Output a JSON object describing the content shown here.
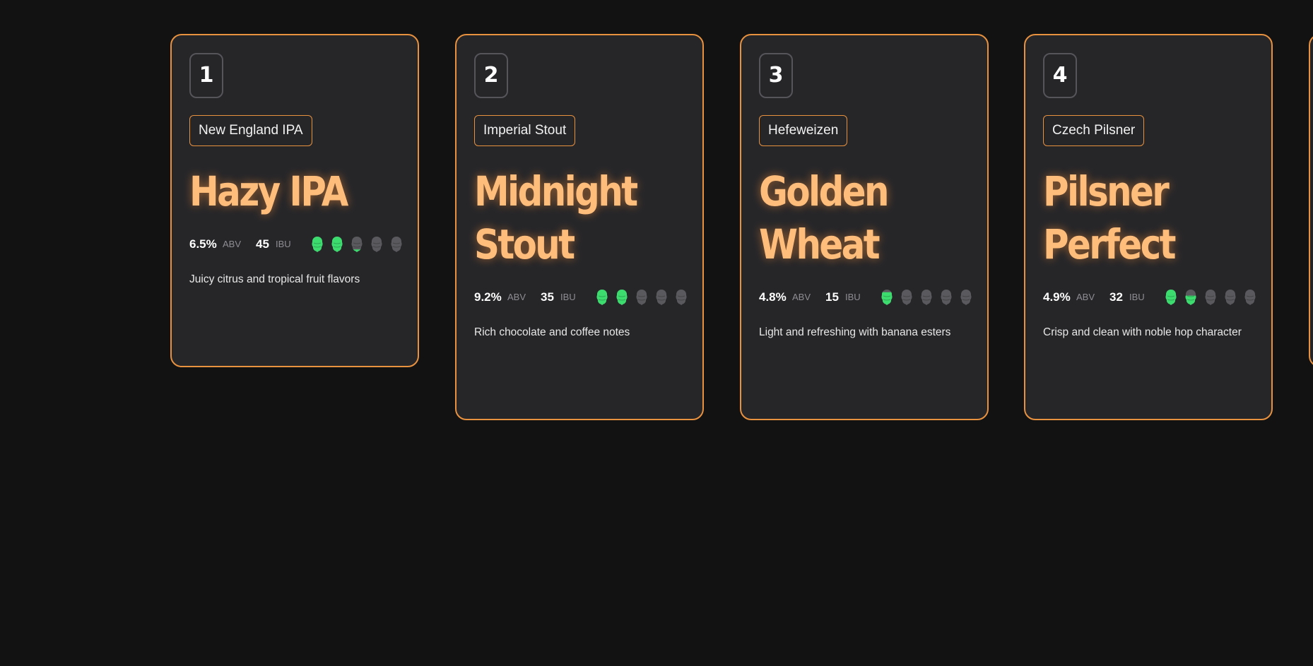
{
  "colors": {
    "background": "#121212",
    "card": "#262629",
    "accent": "#e8913f",
    "title": "#ffbd7c",
    "hop_full": "#3ddc6f",
    "hop_empty": "#5a5a5e"
  },
  "taps": [
    {
      "number": "1",
      "style": "New England IPA",
      "name": "Hazy IPA",
      "abv": "6.5%",
      "abv_label": "ABV",
      "ibu": "45",
      "ibu_label": "IBU",
      "hop_rating": 2.2,
      "hop_max": 5,
      "hop_icon": "hop-icon",
      "description": "Juicy citrus and tropical fruit flavors"
    },
    {
      "number": "2",
      "style": "Imperial Stout",
      "name": "Midnight Stout",
      "abv": "9.2%",
      "abv_label": "ABV",
      "ibu": "35",
      "ibu_label": "IBU",
      "hop_rating": 2.0,
      "hop_max": 5,
      "hop_icon": "hop-icon",
      "description": "Rich chocolate and coffee notes"
    },
    {
      "number": "3",
      "style": "Hefeweizen",
      "name": "Golden Wheat",
      "abv": "4.8%",
      "abv_label": "ABV",
      "ibu": "15",
      "ibu_label": "IBU",
      "hop_rating": 0.8,
      "hop_max": 5,
      "hop_icon": "hop-icon",
      "description": "Light and refreshing with banana esters"
    },
    {
      "number": "4",
      "style": "Czech Pilsner",
      "name": "Pilsner Perfect",
      "abv": "4.9%",
      "abv_label": "ABV",
      "ibu": "32",
      "ibu_label": "IBU",
      "hop_rating": 1.6,
      "hop_max": 5,
      "hop_icon": "hop-icon",
      "description": "Crisp and clean with noble hop character"
    }
  ]
}
